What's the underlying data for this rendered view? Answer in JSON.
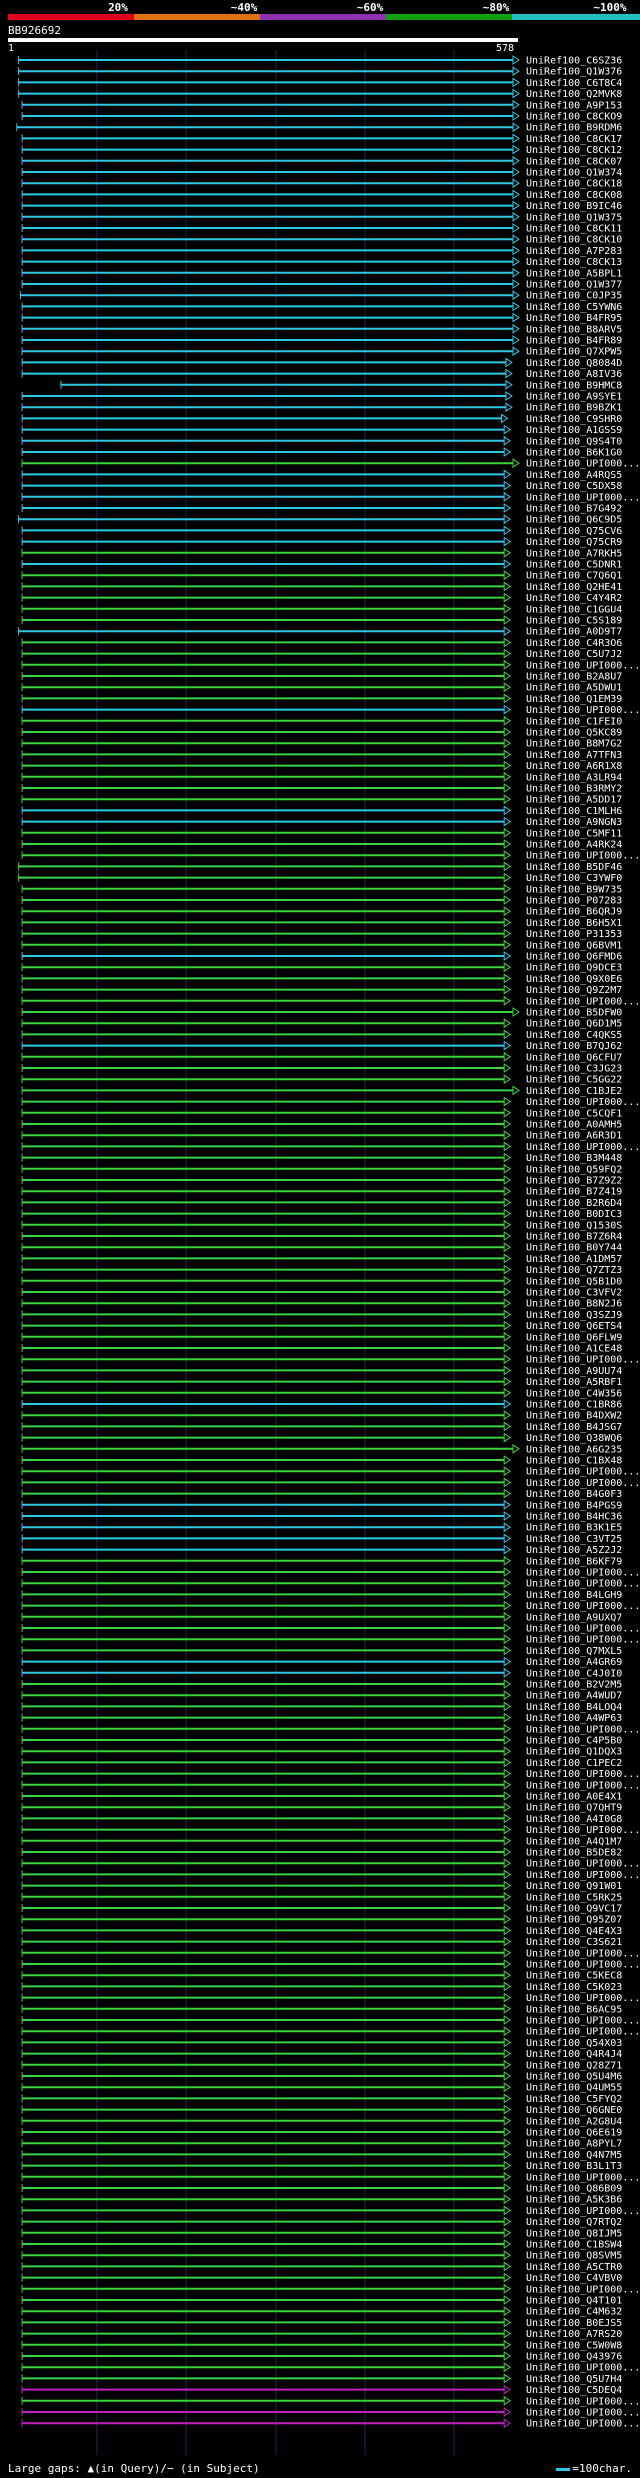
{
  "legend": {
    "labels": [
      "20%",
      "~40%",
      "~60%",
      "~80%",
      "~100%"
    ],
    "colors": [
      "#e0001a",
      "#e07010",
      "#9030b0",
      "#10a010",
      "#20c0c0"
    ]
  },
  "query": {
    "name": "BB926692",
    "start": "1",
    "end": "578",
    "length": 578
  },
  "footer": {
    "gap_text": "Large gaps: ▲(in Query)/− (in Subject)",
    "scale_text": "=100char."
  },
  "chart_data": {
    "type": "alignment",
    "query_length": 578,
    "color_codes": {
      "c": "#2ec8e6",
      "g": "#3cd43c",
      "m": "#c020c0"
    },
    "hits": [
      [
        "UniRef100_C6SZ36",
        12,
        578,
        "c"
      ],
      [
        "UniRef100_Q1W376",
        12,
        578,
        "c"
      ],
      [
        "UniRef100_C6T8C4",
        12,
        578,
        "c"
      ],
      [
        "UniRef100_Q2MVK8",
        12,
        578,
        "c"
      ],
      [
        "UniRef100_A9P153",
        16,
        578,
        "c"
      ],
      [
        "UniRef100_C8CKO9",
        16,
        578,
        "c"
      ],
      [
        "UniRef100_B9RDM6",
        10,
        578,
        "c"
      ],
      [
        "UniRef100_C8CK17",
        16,
        578,
        "c"
      ],
      [
        "UniRef100_C8CK12",
        16,
        578,
        "c"
      ],
      [
        "UniRef100_C8CK07",
        16,
        578,
        "c"
      ],
      [
        "UniRef100_Q1W374",
        16,
        578,
        "c"
      ],
      [
        "UniRef100_C8CK18",
        16,
        578,
        "c"
      ],
      [
        "UniRef100_C8CK08",
        16,
        578,
        "c"
      ],
      [
        "UniRef100_B9IC46",
        16,
        578,
        "c"
      ],
      [
        "UniRef100_Q1W375",
        16,
        578,
        "c"
      ],
      [
        "UniRef100_C8CK11",
        16,
        578,
        "c"
      ],
      [
        "UniRef100_C8CK10",
        16,
        578,
        "c"
      ],
      [
        "UniRef100_A7P283",
        16,
        578,
        "c"
      ],
      [
        "UniRef100_C8CK13",
        16,
        578,
        "c"
      ],
      [
        "UniRef100_A5BPL1",
        16,
        578,
        "c"
      ],
      [
        "UniRef100_Q1W377",
        16,
        578,
        "c"
      ],
      [
        "UniRef100_C0JP35",
        14,
        578,
        "c"
      ],
      [
        "UniRef100_C5YWN6",
        16,
        578,
        "c"
      ],
      [
        "UniRef100_B4FR95",
        16,
        578,
        "c"
      ],
      [
        "UniRef100_B8ARV5",
        16,
        578,
        "c"
      ],
      [
        "UniRef100_B4FR89",
        16,
        578,
        "c"
      ],
      [
        "UniRef100_Q7XPW5",
        16,
        578,
        "c"
      ],
      [
        "UniRef100_Q8084D",
        16,
        570,
        "c"
      ],
      [
        "UniRef100_A8IV36",
        16,
        570,
        "c"
      ],
      [
        "UniRef100_B9HMC8",
        60,
        570,
        "c"
      ],
      [
        "UniRef100_A9SYE1",
        16,
        570,
        "c"
      ],
      [
        "UniRef100_B9BZK1",
        16,
        570,
        "c"
      ],
      [
        "UniRef100_C9SHR0",
        16,
        565,
        "c"
      ],
      [
        "UniRef100_A1GSS9",
        16,
        568,
        "c"
      ],
      [
        "UniRef100_Q9S4T0",
        16,
        568,
        "c"
      ],
      [
        "UniRef100_B6K1G0",
        16,
        568,
        "c"
      ],
      [
        "UniRef100_UPI000...",
        16,
        578,
        "g"
      ],
      [
        "UniRef100_A4RQS5",
        16,
        568,
        "c"
      ],
      [
        "UniRef100_C5DX58",
        16,
        568,
        "c"
      ],
      [
        "UniRef100_UPI000...",
        16,
        568,
        "c"
      ],
      [
        "UniRef100_B7G492",
        16,
        568,
        "c"
      ],
      [
        "UniRef100_Q6C9D5",
        12,
        568,
        "c"
      ],
      [
        "UniRef100_Q75CV6",
        16,
        568,
        "c"
      ],
      [
        "UniRef100_Q75CR9",
        16,
        568,
        "c"
      ],
      [
        "UniRef100_A7RKH5",
        16,
        568,
        "g"
      ],
      [
        "UniRef100_C5DNR1",
        16,
        568,
        "c"
      ],
      [
        "UniRef100_C7Q6Q1",
        16,
        568,
        "g"
      ],
      [
        "UniRef100_Q2HE41",
        16,
        568,
        "g"
      ],
      [
        "UniRef100_C4Y4R2",
        16,
        568,
        "g"
      ],
      [
        "UniRef100_C1GGU4",
        16,
        568,
        "g"
      ],
      [
        "UniRef100_C5S189",
        16,
        568,
        "g"
      ],
      [
        "UniRef100_A0D9T7",
        12,
        568,
        "c"
      ],
      [
        "UniRef100_C4R3O6",
        16,
        568,
        "g"
      ],
      [
        "UniRef100_C5U7J2",
        16,
        568,
        "g"
      ],
      [
        "UniRef100_UPI000...",
        16,
        568,
        "g"
      ],
      [
        "UniRef100_B2A8U7",
        16,
        568,
        "g"
      ],
      [
        "UniRef100_A5DWU1",
        16,
        568,
        "g"
      ],
      [
        "UniRef100_Q1EM39",
        16,
        568,
        "g"
      ],
      [
        "UniRef100_UPI000...",
        16,
        568,
        "c"
      ],
      [
        "UniRef100_C1FEI0",
        16,
        568,
        "g"
      ],
      [
        "UniRef100_Q5KC89",
        16,
        568,
        "g"
      ],
      [
        "UniRef100_B8M7G2",
        16,
        568,
        "g"
      ],
      [
        "UniRef100_A7TFN3",
        16,
        568,
        "g"
      ],
      [
        "UniRef100_A6R1X8",
        16,
        568,
        "g"
      ],
      [
        "UniRef100_A3LR94",
        16,
        568,
        "g"
      ],
      [
        "UniRef100_B3RMY2",
        16,
        568,
        "g"
      ],
      [
        "UniRef100_A5DD17",
        16,
        568,
        "g"
      ],
      [
        "UniRef100_C1MLH6",
        16,
        568,
        "c"
      ],
      [
        "UniRef100_A9NGN3",
        16,
        568,
        "c"
      ],
      [
        "UniRef100_C5MF11",
        16,
        568,
        "g"
      ],
      [
        "UniRef100_A4RK24",
        16,
        568,
        "g"
      ],
      [
        "UniRef100_UPI000...",
        16,
        568,
        "g"
      ],
      [
        "UniRef100_B5DF46",
        12,
        568,
        "g"
      ],
      [
        "UniRef100_C3YWF0",
        12,
        568,
        "g"
      ],
      [
        "UniRef100_B9W735",
        16,
        568,
        "g"
      ],
      [
        "UniRef100_P07283",
        16,
        568,
        "g"
      ],
      [
        "UniRef100_B6QRJ9",
        16,
        568,
        "g"
      ],
      [
        "UniRef100_B6H5X1",
        16,
        568,
        "g"
      ],
      [
        "UniRef100_P31353",
        16,
        568,
        "g"
      ],
      [
        "UniRef100_Q6BVM1",
        16,
        568,
        "g"
      ],
      [
        "UniRef100_Q6FMD6",
        16,
        568,
        "c"
      ],
      [
        "UniRef100_Q9DCE3",
        16,
        568,
        "g"
      ],
      [
        "UniRef100_Q9X0E6",
        16,
        568,
        "g"
      ],
      [
        "UniRef100_Q9Z2M7",
        16,
        568,
        "g"
      ],
      [
        "UniRef100_UPI000...",
        16,
        568,
        "g"
      ],
      [
        "UniRef100_B5DFW0",
        16,
        578,
        "g"
      ],
      [
        "UniRef100_Q6D1M5",
        16,
        568,
        "g"
      ],
      [
        "UniRef100_C4QKS5",
        16,
        568,
        "g"
      ],
      [
        "UniRef100_B7QJ62",
        16,
        568,
        "c"
      ],
      [
        "UniRef100_Q6CFU7",
        16,
        568,
        "g"
      ],
      [
        "UniRef100_C3JG23",
        16,
        568,
        "g"
      ],
      [
        "UniRef100_C5GG22",
        16,
        568,
        "g"
      ],
      [
        "UniRef100_C1BJE2",
        16,
        578,
        "g"
      ],
      [
        "UniRef100_UPI000...",
        16,
        568,
        "g"
      ],
      [
        "UniRef100_C5CQF1",
        16,
        568,
        "g"
      ],
      [
        "UniRef100_A0AMH5",
        16,
        568,
        "g"
      ],
      [
        "UniRef100_A6R3D1",
        16,
        568,
        "g"
      ],
      [
        "UniRef100_UPI000...",
        16,
        568,
        "g"
      ],
      [
        "UniRef100_B3M448",
        16,
        568,
        "g"
      ],
      [
        "UniRef100_Q59FQ2",
        16,
        568,
        "g"
      ],
      [
        "UniRef100_B7Z9Z2",
        16,
        568,
        "g"
      ],
      [
        "UniRef100_B7Z419",
        16,
        568,
        "g"
      ],
      [
        "UniRef100_B2R6D4",
        16,
        568,
        "g"
      ],
      [
        "UniRef100_B0DIC3",
        16,
        568,
        "g"
      ],
      [
        "UniRef100_Q1530S",
        16,
        568,
        "g"
      ],
      [
        "UniRef100_B7Z6R4",
        16,
        568,
        "g"
      ],
      [
        "UniRef100_B0Y744",
        16,
        568,
        "g"
      ],
      [
        "UniRef100_A1DM57",
        16,
        568,
        "g"
      ],
      [
        "UniRef100_Q7ZTZ3",
        16,
        568,
        "g"
      ],
      [
        "UniRef100_Q5B1D0",
        16,
        568,
        "g"
      ],
      [
        "UniRef100_C3VFV2",
        16,
        568,
        "g"
      ],
      [
        "UniRef100_B8N2J6",
        16,
        568,
        "g"
      ],
      [
        "UniRef100_Q3SZJ9",
        16,
        568,
        "g"
      ],
      [
        "UniRef100_Q6ETS4",
        16,
        568,
        "g"
      ],
      [
        "UniRef100_Q6FLW9",
        16,
        568,
        "g"
      ],
      [
        "UniRef100_A1CE48",
        16,
        568,
        "g"
      ],
      [
        "UniRef100_UPI000...",
        16,
        568,
        "g"
      ],
      [
        "UniRef100_A9UU74",
        16,
        568,
        "g"
      ],
      [
        "UniRef100_A5RBF1",
        16,
        568,
        "g"
      ],
      [
        "UniRef100_C4W356",
        16,
        568,
        "g"
      ],
      [
        "UniRef100_C1BR86",
        16,
        568,
        "c"
      ],
      [
        "UniRef100_B4DXW2",
        16,
        568,
        "g"
      ],
      [
        "UniRef100_B4JSG7",
        16,
        568,
        "g"
      ],
      [
        "UniRef100_Q38WQ6",
        16,
        568,
        "g"
      ],
      [
        "UniRef100_A6G235",
        16,
        578,
        "g"
      ],
      [
        "UniRef100_C1BX48",
        16,
        568,
        "g"
      ],
      [
        "UniRef100_UPI000...",
        16,
        568,
        "g"
      ],
      [
        "UniRef100_UPI000...",
        16,
        568,
        "g"
      ],
      [
        "UniRef100_B4G0F3",
        16,
        568,
        "g"
      ],
      [
        "UniRef100_B4PGS9",
        16,
        568,
        "c"
      ],
      [
        "UniRef100_B4HC36",
        16,
        568,
        "c"
      ],
      [
        "UniRef100_B3K1E5",
        16,
        568,
        "c"
      ],
      [
        "UniRef100_C3VT25",
        16,
        568,
        "c"
      ],
      [
        "UniRef100_A5Z2J2",
        16,
        568,
        "c"
      ],
      [
        "UniRef100_B6KF79",
        16,
        568,
        "g"
      ],
      [
        "UniRef100_UPI000...",
        16,
        568,
        "g"
      ],
      [
        "UniRef100_UPI000...",
        16,
        568,
        "g"
      ],
      [
        "UniRef100_B4LGH9",
        16,
        568,
        "g"
      ],
      [
        "UniRef100_UPI000...",
        16,
        568,
        "g"
      ],
      [
        "UniRef100_A9UXQ7",
        16,
        568,
        "g"
      ],
      [
        "UniRef100_UPI000...",
        16,
        568,
        "g"
      ],
      [
        "UniRef100_UPI000...",
        16,
        568,
        "g"
      ],
      [
        "UniRef100_Q7MXL5",
        16,
        568,
        "g"
      ],
      [
        "UniRef100_A4GR69",
        16,
        568,
        "c"
      ],
      [
        "UniRef100_C4J0I0",
        16,
        568,
        "c"
      ],
      [
        "UniRef100_B2V2M5",
        16,
        568,
        "g"
      ],
      [
        "UniRef100_A4WUD7",
        16,
        568,
        "g"
      ],
      [
        "UniRef100_B4LOQ4",
        16,
        568,
        "g"
      ],
      [
        "UniRef100_A4WP63",
        16,
        568,
        "g"
      ],
      [
        "UniRef100_UPI000...",
        16,
        568,
        "g"
      ],
      [
        "UniRef100_C4P5B0",
        16,
        568,
        "g"
      ],
      [
        "UniRef100_Q1DQX3",
        16,
        568,
        "g"
      ],
      [
        "UniRef100_C1PEC2",
        16,
        568,
        "g"
      ],
      [
        "UniRef100_UPI000...",
        16,
        568,
        "g"
      ],
      [
        "UniRef100_UPI000...",
        16,
        568,
        "g"
      ],
      [
        "UniRef100_A0E4X1",
        16,
        568,
        "g"
      ],
      [
        "UniRef100_Q7QHT9",
        16,
        568,
        "g"
      ],
      [
        "UniRef100_A4I0G8",
        16,
        568,
        "g"
      ],
      [
        "UniRef100_UPI000...",
        16,
        568,
        "g"
      ],
      [
        "UniRef100_A4Q1M7",
        16,
        568,
        "g"
      ],
      [
        "UniRef100_B5DE82",
        16,
        568,
        "g"
      ],
      [
        "UniRef100_UPI000...",
        16,
        568,
        "g"
      ],
      [
        "UniRef100_UPI000...",
        16,
        568,
        "g"
      ],
      [
        "UniRef100_Q91W01",
        16,
        568,
        "g"
      ],
      [
        "UniRef100_C5RK25",
        16,
        568,
        "g"
      ],
      [
        "UniRef100_Q9VC17",
        16,
        568,
        "g"
      ],
      [
        "UniRef100_Q95Z07",
        16,
        568,
        "g"
      ],
      [
        "UniRef100_Q4E4X3",
        16,
        568,
        "g"
      ],
      [
        "UniRef100_C3S621",
        16,
        568,
        "g"
      ],
      [
        "UniRef100_UPI000...",
        16,
        568,
        "g"
      ],
      [
        "UniRef100_UPI000...",
        16,
        568,
        "g"
      ],
      [
        "UniRef100_C5KEC8",
        16,
        568,
        "g"
      ],
      [
        "UniRef100_C5K023",
        16,
        568,
        "g"
      ],
      [
        "UniRef100_UPI000...",
        16,
        568,
        "g"
      ],
      [
        "UniRef100_B6AC95",
        16,
        568,
        "g"
      ],
      [
        "UniRef100_UPI000...",
        16,
        568,
        "g"
      ],
      [
        "UniRef100_UPI000...",
        16,
        568,
        "g"
      ],
      [
        "UniRef100_Q54X03",
        16,
        568,
        "g"
      ],
      [
        "UniRef100_Q4R4J4",
        16,
        568,
        "g"
      ],
      [
        "UniRef100_Q28Z71",
        16,
        568,
        "g"
      ],
      [
        "UniRef100_Q5U4M6",
        16,
        568,
        "g"
      ],
      [
        "UniRef100_Q4UM55",
        16,
        568,
        "g"
      ],
      [
        "UniRef100_C5FYQ2",
        16,
        568,
        "g"
      ],
      [
        "UniRef100_Q6GNE0",
        16,
        568,
        "g"
      ],
      [
        "UniRef100_A2G8U4",
        16,
        568,
        "g"
      ],
      [
        "UniRef100_Q6E619",
        16,
        568,
        "g"
      ],
      [
        "UniRef100_A8PYL7",
        16,
        568,
        "g"
      ],
      [
        "UniRef100_Q4N7M5",
        16,
        568,
        "g"
      ],
      [
        "UniRef100_B3L1T3",
        16,
        568,
        "g"
      ],
      [
        "UniRef100_UPI000...",
        16,
        568,
        "g"
      ],
      [
        "UniRef100_Q86B09",
        16,
        568,
        "g"
      ],
      [
        "UniRef100_A5K3B6",
        16,
        568,
        "g"
      ],
      [
        "UniRef100_UPI000...",
        16,
        568,
        "g"
      ],
      [
        "UniRef100_Q7RTQ2",
        16,
        568,
        "g"
      ],
      [
        "UniRef100_Q8IJM5",
        16,
        568,
        "g"
      ],
      [
        "UniRef100_C1BSW4",
        16,
        568,
        "g"
      ],
      [
        "UniRef100_Q8SVM5",
        16,
        568,
        "g"
      ],
      [
        "UniRef100_A5CTR0",
        16,
        568,
        "g"
      ],
      [
        "UniRef100_C4VBV0",
        16,
        568,
        "g"
      ],
      [
        "UniRef100_UPI000...",
        16,
        568,
        "g"
      ],
      [
        "UniRef100_Q4T101",
        16,
        568,
        "g"
      ],
      [
        "UniRef100_C4M632",
        16,
        568,
        "g"
      ],
      [
        "UniRef100_B0EJS5",
        16,
        568,
        "g"
      ],
      [
        "UniRef100_A7RS20",
        16,
        568,
        "g"
      ],
      [
        "UniRef100_C5W0W8",
        16,
        568,
        "g"
      ],
      [
        "UniRef100_Q43976",
        16,
        568,
        "g"
      ],
      [
        "UniRef100_UPI000...",
        16,
        568,
        "g"
      ],
      [
        "UniRef100_Q5U7H4",
        16,
        568,
        "g"
      ],
      [
        "UniRef100_C5DEQ4",
        16,
        568,
        "m"
      ],
      [
        "UniRef100_UPI000...",
        16,
        568,
        "g"
      ],
      [
        "UniRef100_UPI000...",
        16,
        568,
        "m"
      ],
      [
        "UniRef100_UPI000...",
        16,
        568,
        "m"
      ]
    ]
  }
}
